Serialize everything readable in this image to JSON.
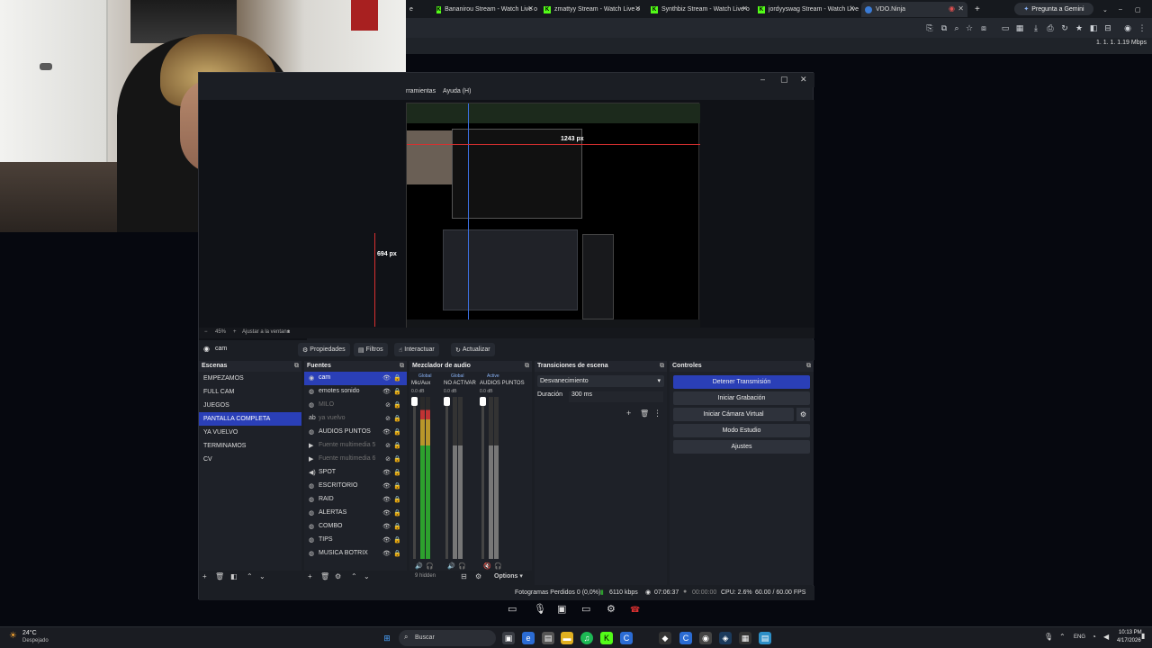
{
  "browser": {
    "tabs": [
      {
        "label": "Bananirou Stream - Watch Live o",
        "icon": "kick-icon"
      },
      {
        "label": "zmattyy Stream - Watch Live o",
        "icon": "kick-icon"
      },
      {
        "label": "Synthbiz Stream - Watch Live o",
        "icon": "kick-icon"
      },
      {
        "label": "jordyyswag Stream - Watch Live",
        "icon": "kick-icon"
      },
      {
        "label": "VDO.Ninja",
        "icon": "vdo-icon"
      }
    ],
    "tab_partial": "e",
    "new_tab": "+",
    "gemini_button": "Pregunta a Gemini",
    "status_text": "1.  1.  1.  1.19 Mbps"
  },
  "obs": {
    "menu_partial": "rramientas",
    "menu_help": "Ayuda (H)",
    "preview": {
      "px_label_1": "1243 px",
      "px_label_2": "694 px"
    },
    "zoom": {
      "value": "45%",
      "fit": "Ajustar a la ventana"
    },
    "source_toolbar": {
      "source_name": "cam",
      "properties": "Propiedades",
      "filters": "Filtros",
      "interact": "Interactuar",
      "refresh": "Actualizar"
    },
    "scenes": {
      "title": "Escenas",
      "items": [
        "EMPEZAMOS",
        "FULL CAM",
        "JUEGOS",
        "PANTALLA COMPLETA",
        "YA VUELVO",
        "TERMINAMOS",
        "CV"
      ],
      "selected_index": 3
    },
    "sources": {
      "title": "Fuentes",
      "items": [
        {
          "name": "cam",
          "icon": "camera-icon",
          "visible": true
        },
        {
          "name": "emotes sonido",
          "icon": "browser-icon",
          "visible": true
        },
        {
          "name": "MILO",
          "icon": "browser-icon",
          "visible": false
        },
        {
          "name": "ya vuelvo",
          "icon": "text-icon",
          "visible": false
        },
        {
          "name": "AUDIOS PUNTOS",
          "icon": "browser-icon",
          "visible": true
        },
        {
          "name": "Fuente multimedia 5",
          "icon": "play-icon",
          "visible": false
        },
        {
          "name": "Fuente multimedia 6",
          "icon": "play-icon",
          "visible": false
        },
        {
          "name": "SPOT",
          "icon": "speaker-icon",
          "visible": true
        },
        {
          "name": "ESCRITORIO",
          "icon": "browser-icon",
          "visible": true
        },
        {
          "name": "RAID",
          "icon": "browser-icon",
          "visible": true
        },
        {
          "name": "ALERTAS",
          "icon": "browser-icon",
          "visible": true
        },
        {
          "name": "COMBO",
          "icon": "browser-icon",
          "visible": true
        },
        {
          "name": "TIPS",
          "icon": "browser-icon",
          "visible": true
        },
        {
          "name": "MUSICA BOTRIX",
          "icon": "browser-icon",
          "visible": true
        }
      ],
      "selected_index": 0
    },
    "mixer": {
      "title": "Mezclador de audio",
      "channels": [
        {
          "name": "Mic/Aux",
          "scope": "Global",
          "db": "0.0 dB",
          "level": 0.85,
          "color": "#2da12d"
        },
        {
          "name": "NO ACTIVAR",
          "scope": "Global",
          "db": "0.0 dB",
          "level": 0.5,
          "color": "#777777"
        },
        {
          "name": "AUDIOS PUNTOS",
          "scope": "Active",
          "db": "0.0 dB",
          "level": 0.5,
          "color": "#777777"
        }
      ],
      "hidden": "9 hidden",
      "options": "Options"
    },
    "transitions": {
      "title": "Transiciones de escena",
      "selected": "Desvanecimiento",
      "duration_label": "Duración",
      "duration_value": "300 ms"
    },
    "controls": {
      "title": "Controles",
      "stop_stream": "Detener Transmisión",
      "start_recording": "Iniciar Grabación",
      "virtual_camera": "Iniciar Cámara Virtual",
      "studio_mode": "Modo Estudio",
      "settings": "Ajustes"
    },
    "status": {
      "dropped": "Fotogramas Perdidos 0 (0,0%)",
      "bitrate": "6110 kbps",
      "live_time": "07:06:37",
      "rec_time": "00:00:00",
      "cpu": "CPU: 2.6%",
      "fps": "60.00 / 60.00 FPS"
    }
  },
  "taskbar": {
    "weather_temp": "24°C",
    "weather_desc": "Despejado",
    "search": "Buscar",
    "lang": "ENG",
    "time": "10:13 PM",
    "date": "4/17/2026"
  },
  "colors": {
    "accent": "#2a3fb7",
    "kick_green": "#53fc18",
    "live_red": "#d83030"
  }
}
